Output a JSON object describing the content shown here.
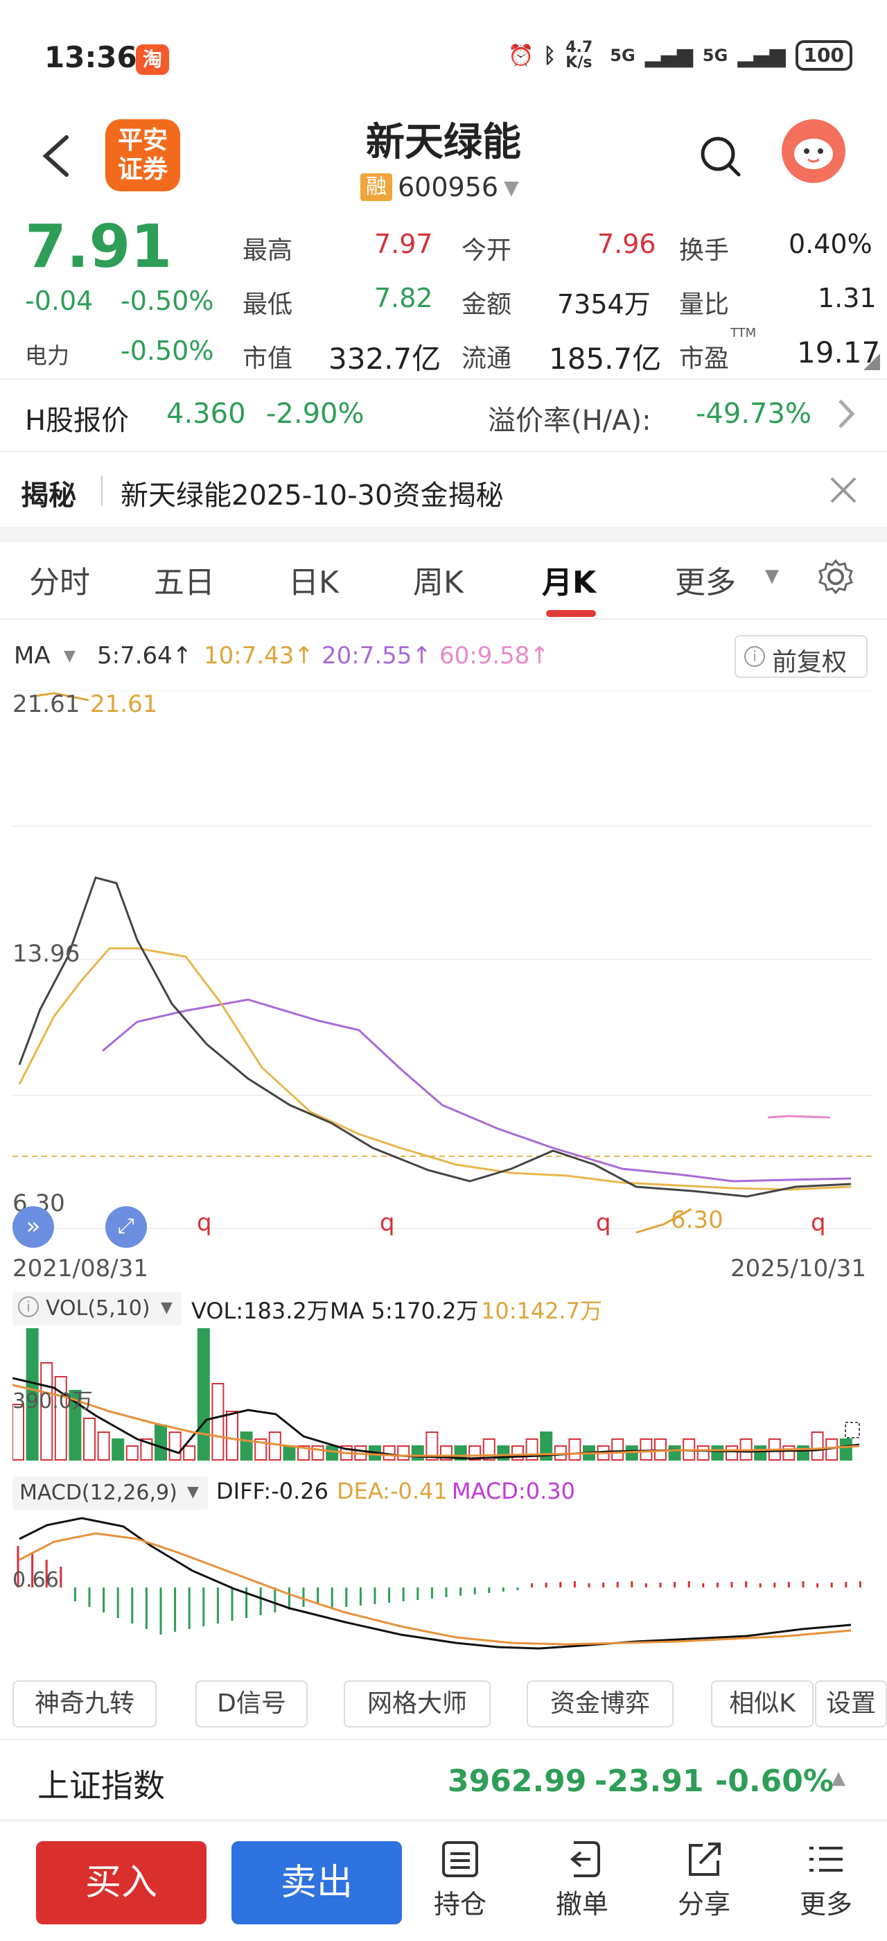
{
  "status_bar": {
    "time": "13:36",
    "app_badge": "淘",
    "net_speed": "4.7 K/s",
    "signal1": "5G",
    "signal2": "5G",
    "battery": "100"
  },
  "header": {
    "broker_logo": "平安证券",
    "stock_name": "新天绿能",
    "margin_badge": "融",
    "stock_code": "600956"
  },
  "quote": {
    "price": "7.91",
    "change": "-0.04",
    "change_pct": "-0.50%",
    "sector_label": "电力",
    "sector_pct": "-0.50%",
    "high_label": "最高",
    "high": "7.97",
    "open_label": "今开",
    "open": "7.96",
    "turnover_label": "换手",
    "turnover": "0.40%",
    "low_label": "最低",
    "low": "7.82",
    "amount_label": "金额",
    "amount": "7354万",
    "vol_ratio_label": "量比",
    "vol_ratio": "1.31",
    "mktcap_label": "市值",
    "mktcap": "332.7亿",
    "float_label": "流通",
    "float": "185.7亿",
    "pe_label": "市盈",
    "pe_sup": "TTM",
    "pe": "19.17"
  },
  "h_share": {
    "label": "H股报价",
    "price": "4.360",
    "change_pct": "-2.90%",
    "premium_label": "溢价率(H/A):",
    "premium": "-49.73%"
  },
  "reveal": {
    "title": "揭秘",
    "text": "新天绿能2025-10-30资金揭秘"
  },
  "tabs": [
    "分时",
    "五日",
    "日K",
    "周K",
    "月K",
    "更多"
  ],
  "chart": {
    "ma_label": "MA",
    "ma5": "5:7.64↑",
    "ma10": "10:7.43↑",
    "ma20": "20:7.55↑",
    "ma60": "60:9.58↑",
    "adjust": "前复权",
    "max_label": "21.61",
    "max_label2": "21.61",
    "mid_label": "13.96",
    "min_label": "6.30",
    "min_label2": "6.30",
    "q_marker": "q",
    "start_date": "2021/08/31",
    "end_date": "2025/10/31",
    "vol_selector": "VOL(5,10)",
    "vol_text": "VOL:183.2万",
    "vol_ma5": "MA 5:170.2万",
    "vol_ma10": "10:142.7万",
    "vol_axis": "390.0万",
    "macd_selector": "MACD(12,26,9)",
    "diff": "DIFF:-0.26",
    "dea": "DEA:-0.41",
    "macd": "MACD:0.30",
    "macd_axis": "0.66",
    "colors": {
      "up": "#d8303a",
      "down": "#2e9e57",
      "ma5": "#333333",
      "ma10": "#e8b64c",
      "ma20": "#a86ad8",
      "ma60": "#e88ac8"
    }
  },
  "tools": [
    "神奇九转",
    "D信号",
    "网格大师",
    "资金博弈",
    "相似K",
    "设置"
  ],
  "index_bar": {
    "name": "上证指数",
    "value": "3962.99",
    "change": "-23.91",
    "change_pct": "-0.60%"
  },
  "bottom": {
    "buy": "买入",
    "sell": "卖出",
    "position": "持仓",
    "cancel": "撤单",
    "share": "分享",
    "more": "更多"
  }
}
